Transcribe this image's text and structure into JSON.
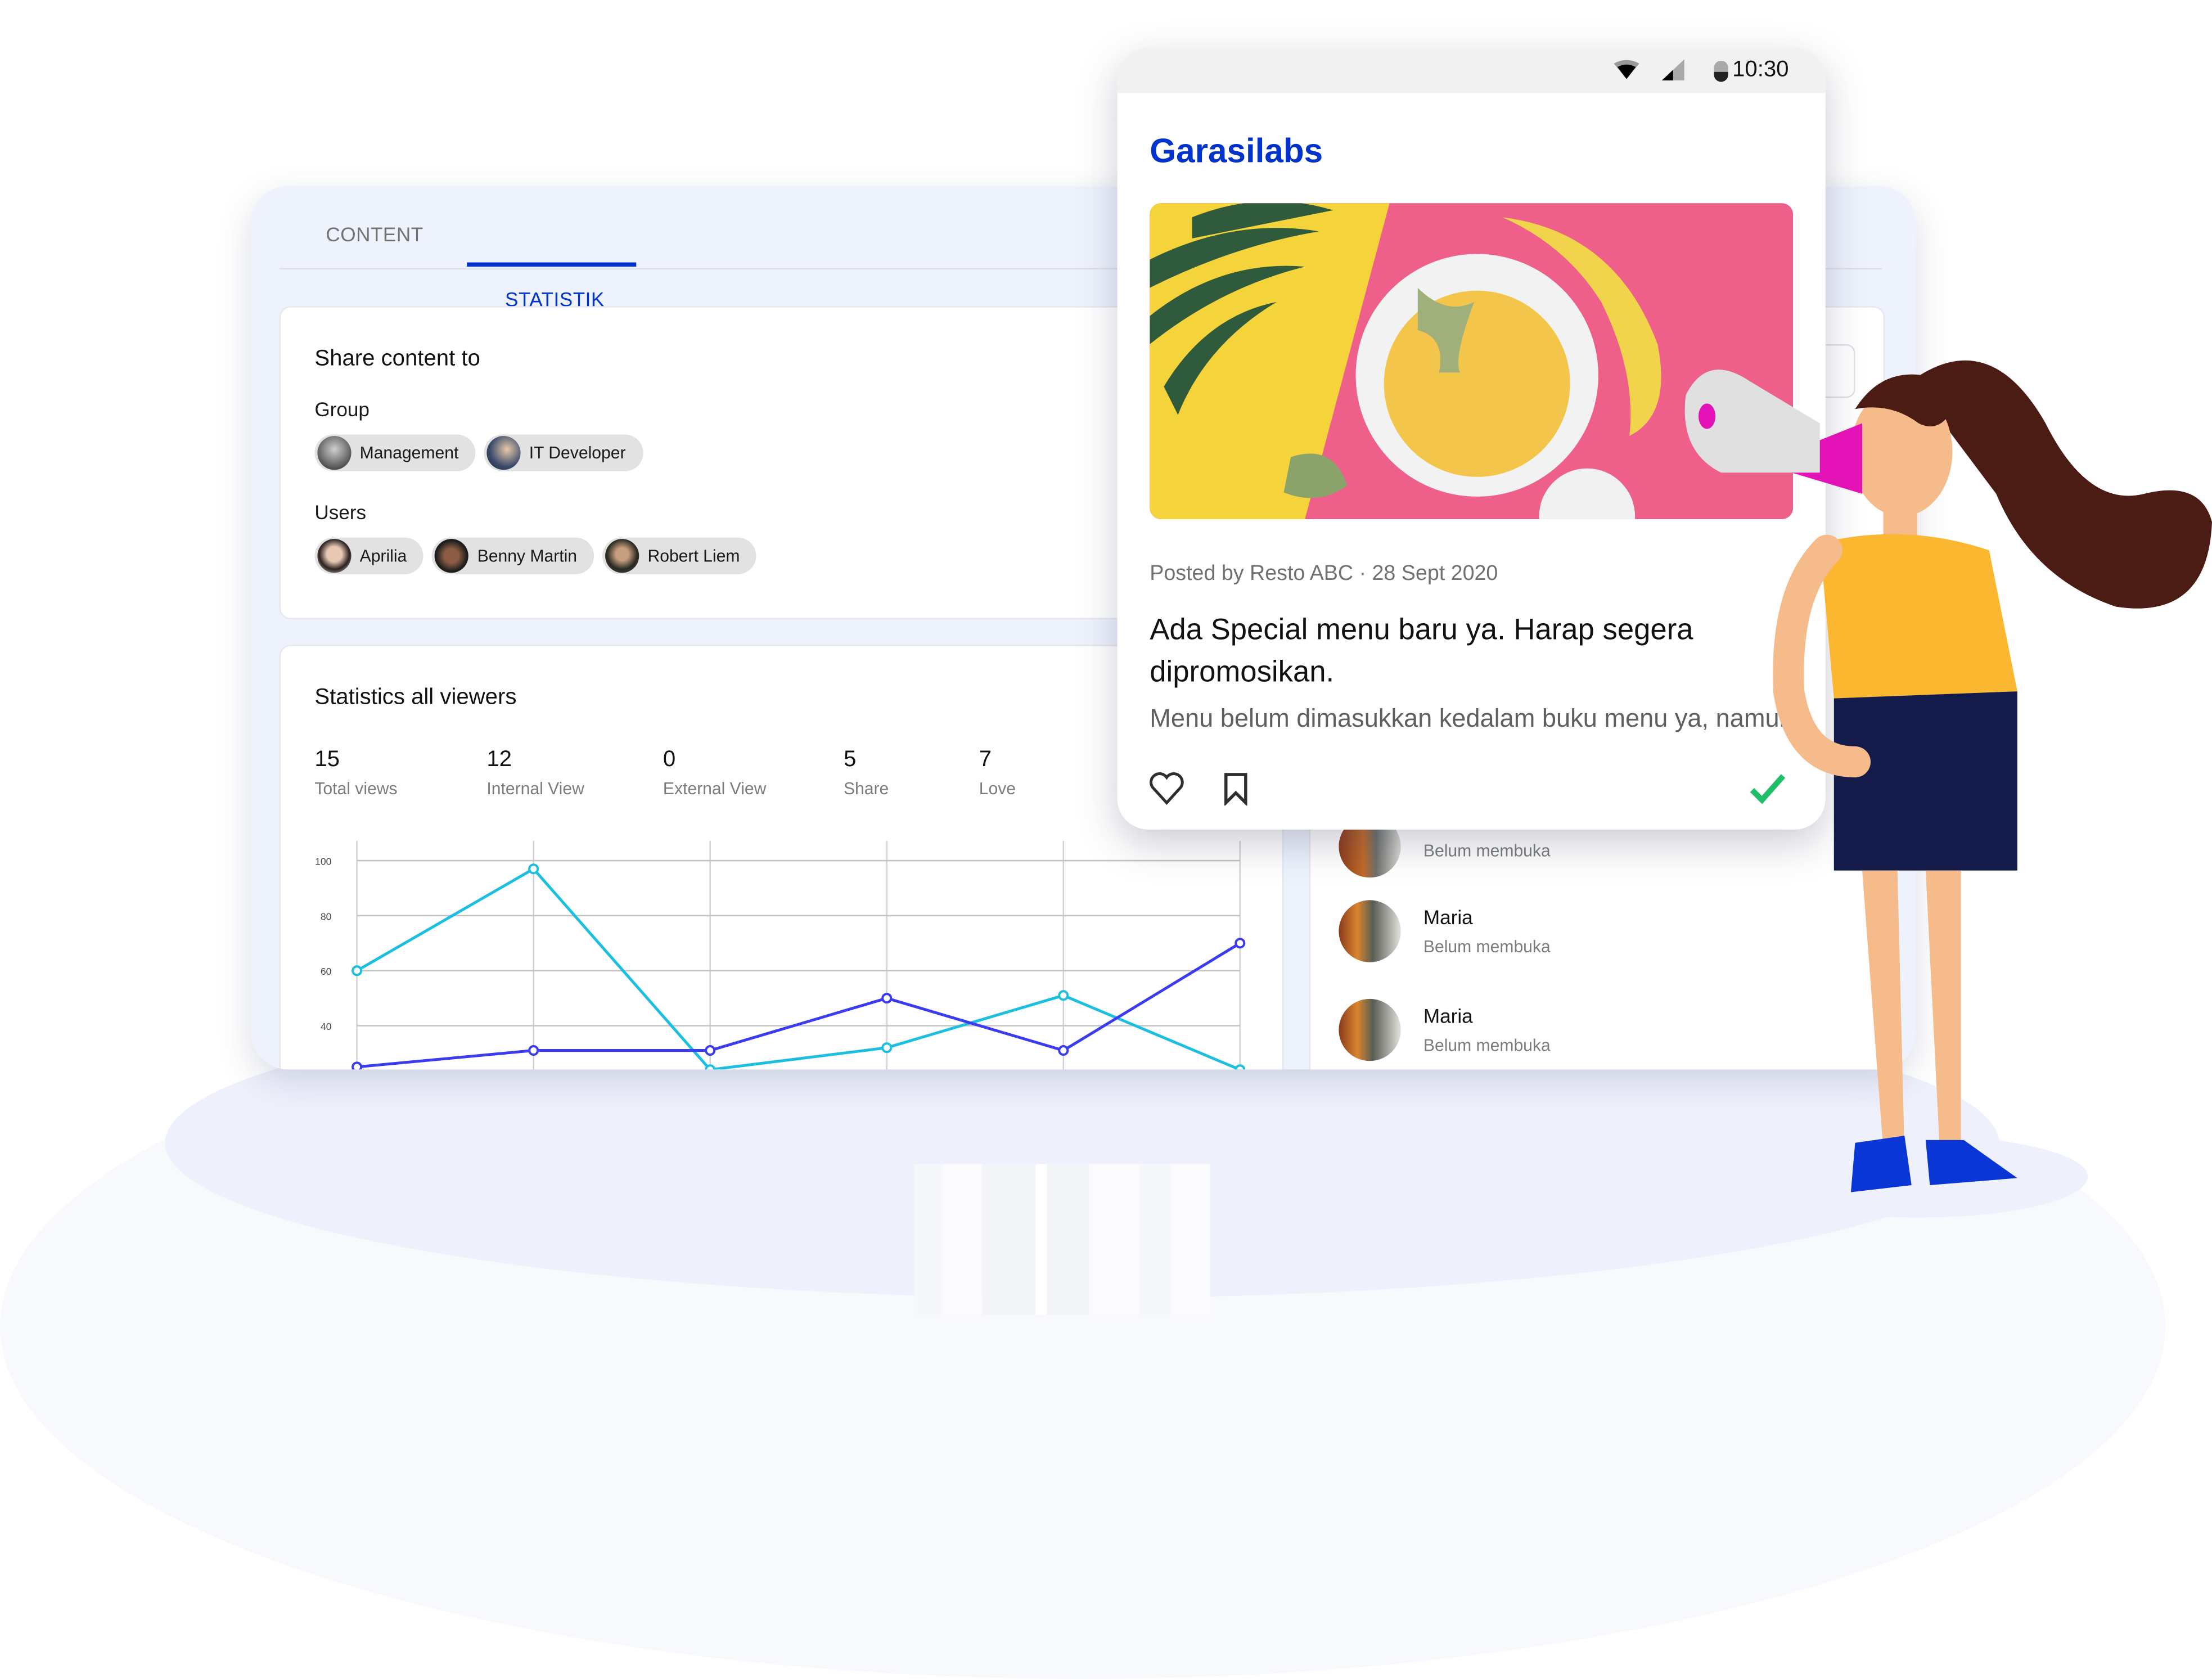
{
  "tabs": [
    {
      "label": "CONTENT",
      "active": false
    },
    {
      "label": "STATISTIK",
      "active": true
    }
  ],
  "share": {
    "title": "Share content to",
    "group_label": "Group",
    "groups": [
      {
        "label": "Management"
      },
      {
        "label": "IT Developer"
      }
    ],
    "users_label": "Users",
    "users": [
      {
        "label": "Aprilia"
      },
      {
        "label": "Benny Martin"
      },
      {
        "label": "Robert Liem"
      }
    ]
  },
  "statistics": {
    "title": "Statistics all viewers",
    "items": [
      {
        "value": "15",
        "label": "Total views"
      },
      {
        "value": "12",
        "label": "Internal View"
      },
      {
        "value": "0",
        "label": "External View"
      },
      {
        "value": "5",
        "label": "Share"
      },
      {
        "value": "7",
        "label": "Love"
      }
    ]
  },
  "chart_data": {
    "type": "line",
    "title": "",
    "xlabel": "",
    "ylabel": "",
    "x": [
      1,
      2,
      3,
      4,
      5,
      6
    ],
    "y_ticks": [
      "100",
      "80",
      "60",
      "40"
    ],
    "ylim": [
      24,
      106
    ],
    "grid": true,
    "series": [
      {
        "name": "series-cyan",
        "color": "#1cbfdf",
        "values": [
          60,
          97,
          24,
          32,
          51,
          24
        ]
      },
      {
        "name": "series-blue",
        "color": "#3b3cef",
        "values": [
          25,
          31,
          31,
          50,
          31,
          70
        ]
      }
    ]
  },
  "viewers": {
    "search_placeholder": "",
    "rows": [
      {
        "name": "",
        "status": "Belum membuka"
      },
      {
        "name": "Maria",
        "status": "Belum membuka"
      },
      {
        "name": "Maria",
        "status": "Belum membuka"
      }
    ]
  },
  "phone": {
    "time": "10:30",
    "brand": "Garasilabs",
    "meta": "Posted by Resto ABC · 28 Sept 2020",
    "headline": "Ada Special menu baru ya. Harap segera dipromosikan.",
    "body": "Menu belum dimasukkan kedalam buku menu ya, namun",
    "colors": {
      "brand": "#0033cc",
      "check": "#1fbf6a"
    }
  }
}
